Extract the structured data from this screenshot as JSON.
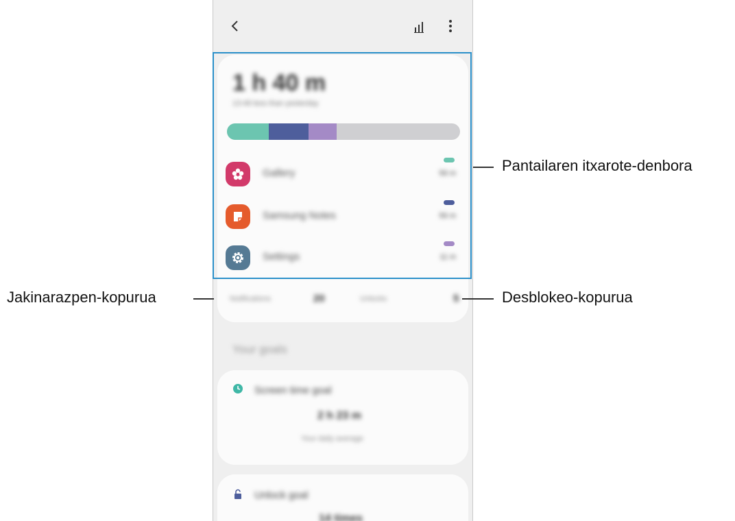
{
  "header": {
    "back_icon": "chevron-left-icon",
    "stats_icon": "bar-chart-icon",
    "more_icon": "more-vert-icon"
  },
  "summary": {
    "total_time": "1 h 40 m",
    "comparison": "13:48 less than yesterday",
    "usage_segments": [
      {
        "app": "Gallery",
        "fraction": 0.18,
        "color": "#6cc5b0"
      },
      {
        "app": "Samsung Notes",
        "fraction": 0.17,
        "color": "#4e5e9c"
      },
      {
        "app": "Settings",
        "fraction": 0.12,
        "color": "#a48ac6"
      }
    ],
    "remaining_color": "#cfcfd2"
  },
  "apps": [
    {
      "name": "Gallery",
      "time": "56 m",
      "color": "#6cc5b0",
      "icon_bg": "#d23a6a",
      "icon": "flower-icon"
    },
    {
      "name": "Samsung Notes",
      "time": "56 m",
      "color": "#4e5e9c",
      "icon_bg": "#e55b2c",
      "icon": "note-icon"
    },
    {
      "name": "Settings",
      "time": "11 m",
      "color": "#a48ac6",
      "icon_bg": "#557a94",
      "icon": "gear-icon"
    }
  ],
  "counts": {
    "notifications_label": "Notifications",
    "notifications_value": "20",
    "unlocks_label": "Unlocks",
    "unlocks_value": "5"
  },
  "goals": {
    "section_title": "Your goals",
    "screen_time": {
      "title": "Screen time goal",
      "value": "2 h 23 m",
      "subtitle": "Your daily average",
      "icon": "clock-icon",
      "icon_color": "#3fb7a6"
    },
    "unlock": {
      "title": "Unlock goal",
      "value": "14 times",
      "icon": "unlock-icon",
      "icon_color": "#4e5e9c"
    }
  },
  "callouts": {
    "screen_time": "Pantailaren itxarote-denbora",
    "notifications": "Jakinarazpen-kopurua",
    "unlocks": "Desblokeo-kopurua"
  },
  "colors": {
    "highlight": "#2a8fc9"
  }
}
